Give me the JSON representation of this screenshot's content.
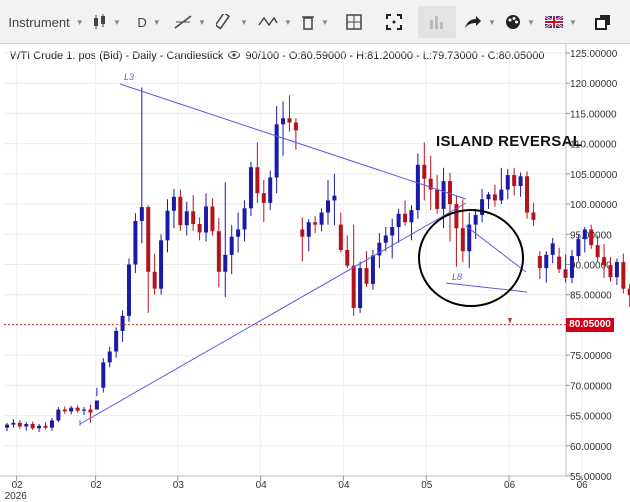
{
  "toolbar": {
    "instrument_label": "Instrument",
    "timeframe_label": "D",
    "icons": [
      "candlestick-icon",
      "line-tool-icon",
      "ruler-icon",
      "zigzag-icon",
      "delete-icon",
      "layout-icon",
      "fullscreen-icon",
      "bar-chart-icon",
      "share-icon",
      "palette-icon",
      "uk-flag-icon",
      "popout-icon"
    ]
  },
  "header": {
    "instrument": "WTI Crude 1. pos (Bid) - Daily - Candlestick",
    "stats": "90/100 - O:80.59000 - H:81.20000 - L:79.73000 - C:80.05000"
  },
  "annotation": {
    "text": "ISLAND REVERSAL"
  },
  "price_tag": {
    "text": "80.05000"
  },
  "drawing_labels": {
    "top": "L3",
    "bottom": "L8"
  },
  "colors": {
    "up": "#1a1aa6",
    "down": "#b3141b",
    "trendline": "#5a5ae6",
    "price_line": "#c0392b",
    "circle": "#000000"
  },
  "chart_data": {
    "type": "candlestick",
    "title": "WTI Crude 1. pos (Bid) - Daily - Candlestick",
    "ylim": [
      55,
      125
    ],
    "yticks": [
      "125.00000",
      "120.00000",
      "115.00000",
      "110.00000",
      "105.00000",
      "100.00000",
      "95.00000",
      "90.00000",
      "85.00000",
      "80.00000",
      "75.00000",
      "70.00000",
      "65.00000",
      "60.00000",
      "55.00000"
    ],
    "ytick_values": [
      125,
      120,
      115,
      110,
      105,
      100,
      95,
      90,
      85,
      80,
      75,
      70,
      65,
      60,
      55
    ],
    "xticks": [
      {
        "label": "02",
        "sub": "2026",
        "index": 1.5
      },
      {
        "label": "02",
        "sub": "",
        "index": 13.8
      },
      {
        "label": "03",
        "sub": "",
        "index": 26.6
      },
      {
        "label": "04",
        "sub": "",
        "index": 39.5
      },
      {
        "label": "04",
        "sub": "",
        "index": 52.4
      },
      {
        "label": "05",
        "sub": "",
        "index": 65.3
      },
      {
        "label": "06",
        "sub": "",
        "index": 78.2
      },
      {
        "label": "06",
        "sub": "",
        "index": 89.5
      }
    ],
    "current_price": 80.05,
    "candles": [
      [
        63.0,
        63.8,
        62.4,
        63.5
      ],
      [
        63.5,
        64.4,
        63.0,
        63.8
      ],
      [
        63.8,
        64.2,
        62.8,
        63.2
      ],
      [
        63.2,
        63.9,
        62.5,
        63.6
      ],
      [
        63.6,
        64.0,
        62.6,
        62.9
      ],
      [
        62.9,
        63.6,
        62.3,
        63.3
      ],
      [
        63.3,
        63.9,
        62.7,
        63.0
      ],
      [
        63.0,
        64.6,
        62.5,
        64.2
      ],
      [
        64.2,
        66.4,
        63.9,
        66.0
      ],
      [
        66.0,
        66.5,
        65.3,
        65.7
      ],
      [
        65.7,
        66.6,
        65.2,
        66.3
      ],
      [
        66.3,
        66.7,
        65.5,
        65.8
      ],
      [
        65.8,
        66.4,
        65.1,
        66.0
      ],
      [
        66.0,
        66.8,
        63.8,
        65.5
      ],
      [
        66.0,
        68.2,
        69.6,
        67.5
      ],
      [
        69.6,
        74.5,
        68.8,
        73.8
      ],
      [
        73.8,
        76.4,
        73.0,
        75.6
      ],
      [
        75.6,
        79.6,
        74.6,
        79.0
      ],
      [
        79.0,
        82.4,
        77.2,
        81.5
      ],
      [
        81.5,
        91.0,
        80.5,
        90.0
      ],
      [
        90.0,
        98.5,
        88.6,
        97.2
      ],
      [
        97.2,
        119.3,
        93.5,
        99.5
      ],
      [
        99.5,
        99.8,
        82.0,
        88.8
      ],
      [
        88.8,
        91.8,
        85.0,
        86.0
      ],
      [
        86.0,
        95.0,
        85.0,
        94.0
      ],
      [
        94.0,
        100.8,
        92.0,
        98.9
      ],
      [
        98.9,
        102.5,
        96.0,
        101.2
      ],
      [
        101.2,
        102.4,
        95.6,
        96.5
      ],
      [
        96.5,
        100.4,
        94.8,
        98.8
      ],
      [
        98.8,
        101.5,
        95.6,
        96.7
      ],
      [
        96.7,
        97.8,
        94.0,
        95.3
      ],
      [
        95.3,
        101.8,
        93.8,
        99.6
      ],
      [
        99.6,
        101.0,
        94.8,
        95.5
      ],
      [
        95.5,
        97.7,
        86.2,
        88.8
      ],
      [
        88.8,
        103.6,
        84.6,
        91.6
      ],
      [
        91.6,
        96.5,
        88.4,
        94.6
      ],
      [
        94.6,
        98.6,
        92.0,
        95.8
      ],
      [
        95.8,
        100.6,
        93.8,
        99.3
      ],
      [
        99.3,
        107.0,
        98.0,
        106.1
      ],
      [
        106.1,
        110.2,
        100.2,
        101.8
      ],
      [
        101.8,
        104.0,
        97.0,
        100.2
      ],
      [
        100.2,
        105.5,
        99.0,
        104.4
      ],
      [
        104.4,
        116.2,
        101.8,
        113.2
      ],
      [
        113.2,
        117.0,
        108.0,
        114.2
      ],
      [
        114.2,
        118.0,
        112.0,
        113.5
      ],
      [
        113.5,
        114.2,
        109.0,
        112.2
      ],
      [
        95.8,
        97.8,
        90.5,
        94.6
      ],
      [
        94.6,
        97.5,
        92.2,
        97.0
      ],
      [
        97.0,
        98.0,
        95.2,
        96.6
      ],
      [
        96.6,
        99.3,
        95.5,
        98.6
      ],
      [
        98.6,
        104.0,
        96.6,
        100.6
      ],
      [
        100.6,
        105.0,
        96.5,
        101.4
      ],
      [
        96.6,
        98.6,
        92.0,
        92.4
      ],
      [
        92.4,
        94.8,
        89.4,
        89.8
      ],
      [
        89.8,
        96.6,
        81.5,
        82.8
      ],
      [
        82.8,
        90.5,
        82.0,
        89.4
      ],
      [
        89.4,
        92.2,
        86.3,
        86.8
      ],
      [
        86.8,
        92.4,
        85.8,
        91.5
      ],
      [
        91.5,
        95.2,
        89.4,
        93.6
      ],
      [
        93.6,
        96.2,
        92.2,
        94.8
      ],
      [
        94.8,
        97.6,
        91.0,
        96.2
      ],
      [
        96.2,
        99.2,
        93.6,
        98.4
      ],
      [
        98.4,
        100.6,
        96.4,
        97.0
      ],
      [
        97.0,
        99.8,
        94.0,
        99.0
      ],
      [
        99.0,
        108.4,
        97.6,
        106.5
      ],
      [
        106.5,
        110.2,
        100.6,
        104.2
      ],
      [
        104.2,
        108.0,
        99.0,
        102.4
      ],
      [
        102.4,
        104.8,
        98.4,
        99.2
      ],
      [
        99.2,
        106.0,
        96.0,
        103.8
      ],
      [
        103.8,
        105.2,
        93.8,
        100.0
      ],
      [
        100.0,
        101.4,
        89.6,
        96.0
      ],
      [
        96.0,
        100.8,
        90.4,
        92.2
      ],
      [
        92.2,
        98.6,
        89.4,
        96.6
      ],
      [
        96.6,
        99.2,
        94.2,
        98.2
      ],
      [
        98.2,
        102.5,
        97.0,
        100.8
      ],
      [
        100.8,
        102.0,
        99.2,
        101.6
      ],
      [
        101.6,
        103.2,
        99.6,
        100.6
      ],
      [
        100.6,
        106.0,
        100.0,
        102.4
      ],
      [
        102.4,
        105.8,
        100.8,
        104.8
      ],
      [
        104.8,
        106.0,
        101.4,
        103.0
      ],
      [
        103.0,
        105.2,
        101.2,
        104.6
      ],
      [
        104.6,
        105.4,
        97.6,
        98.6
      ],
      [
        98.6,
        100.2,
        96.4,
        97.4
      ],
      [
        91.4,
        92.2,
        87.6,
        89.4
      ],
      [
        89.4,
        92.2,
        87.0,
        91.6
      ],
      [
        91.6,
        94.4,
        90.2,
        93.5
      ],
      [
        91.3,
        92.8,
        88.6,
        89.2
      ],
      [
        89.2,
        91.6,
        87.0,
        87.8
      ],
      [
        87.8,
        92.4,
        86.9,
        91.4
      ],
      [
        91.4,
        95.0,
        90.6,
        94.2
      ],
      [
        94.2,
        96.2,
        92.0,
        95.8
      ],
      [
        95.8,
        96.6,
        92.6,
        93.2
      ],
      [
        93.2,
        94.8,
        90.4,
        91.2
      ],
      [
        91.2,
        93.4,
        87.8,
        89.9
      ],
      [
        89.9,
        91.2,
        87.2,
        87.9
      ],
      [
        87.9,
        91.0,
        86.6,
        90.4
      ],
      [
        90.4,
        91.8,
        85.2,
        86.0
      ],
      [
        86.0,
        86.8,
        83.0,
        84.9
      ],
      [
        80.59,
        81.2,
        79.73,
        80.05
      ]
    ]
  }
}
